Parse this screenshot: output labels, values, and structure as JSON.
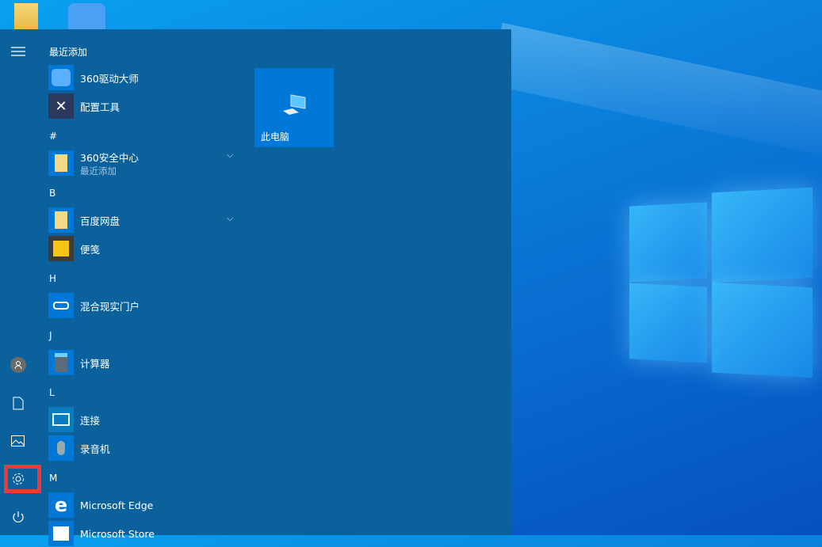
{
  "start_menu": {
    "groups": [
      {
        "header": "最近添加",
        "items": [
          {
            "label": "360驱动大师"
          },
          {
            "label": "配置工具"
          }
        ]
      },
      {
        "header": "#",
        "items": [
          {
            "label": "360安全中心",
            "sublabel": "最近添加"
          }
        ]
      },
      {
        "header": "B",
        "items": [
          {
            "label": "百度网盘"
          },
          {
            "label": "便笺"
          }
        ]
      },
      {
        "header": "H",
        "items": [
          {
            "label": "混合现实门户"
          }
        ]
      },
      {
        "header": "J",
        "items": [
          {
            "label": "计算器"
          }
        ]
      },
      {
        "header": "L",
        "items": [
          {
            "label": "连接"
          },
          {
            "label": "录音机"
          }
        ]
      },
      {
        "header": "M",
        "items": [
          {
            "label": "Microsoft Edge"
          },
          {
            "label": "Microsoft Store"
          }
        ]
      }
    ],
    "tiles": [
      {
        "label": "此电脑"
      }
    ]
  },
  "colors": {
    "highlight": "#f03a3a",
    "accent": "#0078d7"
  }
}
